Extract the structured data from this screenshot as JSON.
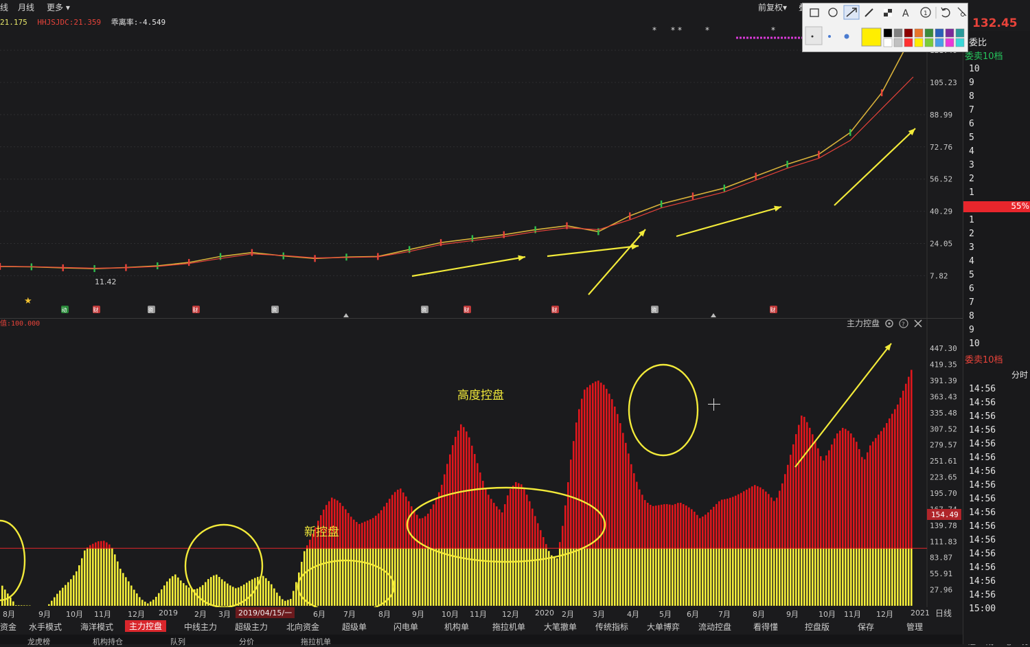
{
  "topbar": {
    "items": [
      "线",
      "月线",
      "更多 ▾"
    ],
    "right_items": [
      "前复权▾",
      "叠"
    ]
  },
  "infobar": {
    "items": [
      {
        "text": "21.175",
        "color": "#e8e86a"
      },
      {
        "text": "HHJSJDC:21.359",
        "color": "#e8433a"
      },
      {
        "text": "乖离率:-4.549",
        "color": "#e6e6e6"
      }
    ]
  },
  "upper_chart": {
    "min_label": "11.42",
    "price_now": "132.45",
    "badges": [
      "动",
      "财",
      "资",
      "财",
      "资",
      "资",
      "财",
      "财",
      "资",
      "财"
    ]
  },
  "lower_chart": {
    "title": "主力控盘",
    "left_label": "值:100.000",
    "current_value": "154.49"
  },
  "annotations": {
    "new_control": "新控盘",
    "high_control": "高度控盘"
  },
  "date_marker": "2019/04/15/一",
  "period_label": "日线",
  "tabs": [
    "资金",
    "水手模式",
    "海洋模式",
    "主力控盘",
    "中线主力",
    "超级主力",
    "北向资金",
    "超级单",
    "闪电单",
    "机构单",
    "拖拉机单",
    "大笔撤单",
    "传统指标",
    "大单博弈",
    "流动控盘",
    "看得懂",
    "控盘版",
    "保存",
    "管理"
  ],
  "active_tab": "主力控盘",
  "bottom_tabs": [
    "龙虎榜",
    "机构持仓",
    "队列",
    "分价",
    "拖拉机单"
  ],
  "right_panel": {
    "ratio_label": "委比",
    "sell_label": "委卖10档",
    "sell_levels": [
      "10",
      "9",
      "8",
      "7",
      "6",
      "5",
      "4",
      "3",
      "2",
      "1"
    ],
    "pct_label": "55%",
    "buy_levels": [
      "1",
      "2",
      "3",
      "4",
      "5",
      "6",
      "7",
      "8",
      "9",
      "10"
    ],
    "buy_label": "委卖10档",
    "time_header": "分时",
    "times": [
      "14:56",
      "14:56",
      "14:56",
      "14:56",
      "14:56",
      "14:56",
      "14:56",
      "14:56",
      "14:56",
      "14:56",
      "14:56",
      "14:56",
      "14:56",
      "14:56",
      "14:56",
      "14:56",
      "15:00"
    ],
    "bottom_items": [
      "逐",
      "成",
      "笔",
      "分"
    ]
  },
  "chart_data": [
    {
      "type": "line",
      "title": "",
      "y_ticks": [
        "121.46",
        "105.23",
        "88.99",
        "72.76",
        "56.52",
        "40.29",
        "24.05",
        "7.82"
      ],
      "ylim": [
        0,
        135
      ],
      "x": [
        "2018-08",
        "2018-09",
        "2018-10",
        "2018-11",
        "2018-12",
        "2019-01",
        "2019-02",
        "2019-03",
        "2019-04",
        "2019-05",
        "2019-06",
        "2019-07",
        "2019-08",
        "2019-09",
        "2019-10",
        "2019-11",
        "2019-12",
        "2020-01",
        "2020-02",
        "2020-03",
        "2020-04",
        "2020-05",
        "2020-06",
        "2020-07",
        "2020-08",
        "2020-09",
        "2020-10",
        "2020-11",
        "2020-12",
        "2021-01"
      ],
      "series": [
        {
          "values": [
            12.5,
            12.3,
            11.8,
            11.4,
            11.9,
            12.8,
            14.5,
            17.5,
            19.5,
            17.8,
            16.5,
            17.2,
            17.5,
            21,
            24.5,
            26.5,
            28.5,
            31,
            33,
            30,
            38,
            44,
            48,
            52,
            58,
            64,
            69,
            80,
            100,
            130
          ]
        },
        {
          "values": [
            12.6,
            12.4,
            12.0,
            11.6,
            11.8,
            12.5,
            14.0,
            16.5,
            18.8,
            18.0,
            16.8,
            17.0,
            17.3,
            20,
            23.5,
            25.5,
            27.5,
            30,
            32,
            31,
            36,
            42,
            46,
            50,
            56,
            62,
            67,
            76,
            92,
            108
          ]
        }
      ]
    },
    {
      "type": "bar",
      "title": "主力控盘",
      "y_ticks": [
        "447.30",
        "419.35",
        "391.39",
        "363.43",
        "335.48",
        "307.52",
        "279.57",
        "251.61",
        "223.65",
        "195.70",
        "167.74",
        "139.78",
        "111.83",
        "83.87",
        "55.91",
        "27.96"
      ],
      "ylim": [
        0,
        475
      ],
      "threshold": 100,
      "x_labels": [
        "8月",
        "9月",
        "10月",
        "11月",
        "12月",
        "2019",
        "2月",
        "3月",
        "4月",
        "5月",
        "6月",
        "7月",
        "8月",
        "9月",
        "10月",
        "11月",
        "12月",
        "2020",
        "2月",
        "3月",
        "4月",
        "5月",
        "6月",
        "7月",
        "8月",
        "9月",
        "10月",
        "11月",
        "12月",
        "2021"
      ],
      "x": [
        0,
        6,
        20,
        22,
        25,
        30,
        33,
        35,
        36,
        38,
        42,
        45,
        48,
        50,
        52,
        55,
        58,
        61,
        64,
        67,
        70,
        73,
        76,
        79,
        82,
        85,
        88,
        91,
        94,
        97,
        100,
        103,
        106,
        109,
        112,
        115,
        118,
        121,
        124,
        127,
        130,
        133,
        136,
        139,
        142,
        145,
        148,
        151,
        154,
        157,
        160,
        163,
        166,
        169,
        172,
        175,
        178,
        181,
        184,
        187,
        190,
        193,
        196,
        199,
        202,
        205,
        208,
        211,
        214,
        217,
        220,
        223,
        226,
        229,
        232,
        235,
        238,
        241,
        244,
        247,
        250,
        253,
        256,
        259,
        262,
        265,
        268,
        271,
        274,
        277,
        280,
        283,
        286,
        289,
        292,
        295,
        298,
        301,
        304,
        307,
        310,
        313,
        316,
        319,
        322,
        325,
        328,
        331,
        334,
        337,
        340,
        343,
        346,
        349,
        352,
        355,
        358,
        361,
        364,
        367,
        370,
        373,
        376,
        379,
        382,
        385,
        388,
        391,
        394,
        397,
        400
      ],
      "values": [
        35,
        1,
        0,
        10,
        25,
        45,
        62,
        82,
        95,
        104,
        112,
        113,
        104,
        85,
        64,
        46,
        28,
        12,
        4,
        12,
        28,
        45,
        55,
        42,
        32,
        28,
        35,
        48,
        55,
        45,
        36,
        30,
        36,
        44,
        50,
        52,
        40,
        22,
        8,
        12,
        50,
        96,
        120,
        148,
        172,
        188,
        182,
        168,
        152,
        142,
        147,
        152,
        162,
        178,
        195,
        205,
        188,
        166,
        150,
        158,
        178,
        205,
        250,
        290,
        317,
        298,
        262,
        222,
        192,
        175,
        162,
        200,
        215,
        210,
        182,
        150,
        120,
        90,
        80,
        150,
        250,
        330,
        375,
        385,
        392,
        383,
        362,
        330,
        288,
        242,
        205,
        182,
        173,
        175,
        177,
        175,
        180,
        174,
        166,
        152,
        160,
        172,
        184,
        186,
        190,
        196,
        203,
        210,
        205,
        195,
        180,
        210,
        250,
        295,
        335,
        312,
        284,
        250,
        272,
        298,
        310,
        302,
        284,
        250,
        280,
        295,
        310,
        330,
        350,
        380,
        410,
        445,
        470
      ]
    }
  ]
}
